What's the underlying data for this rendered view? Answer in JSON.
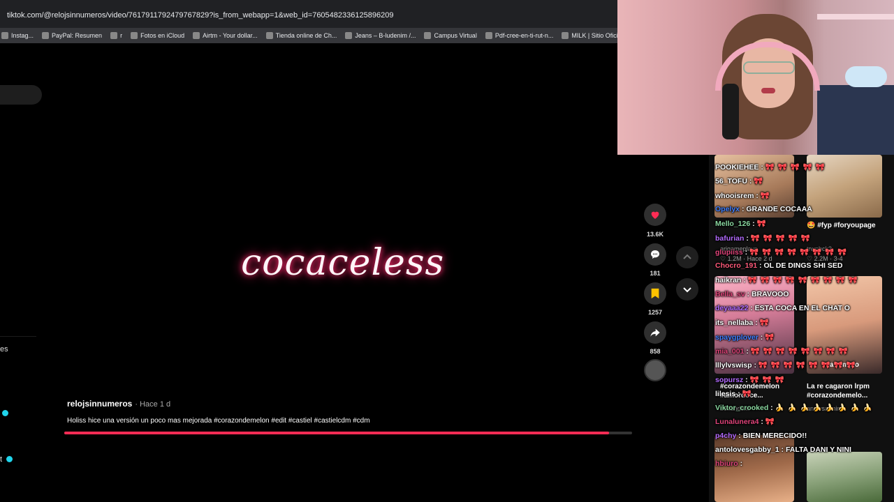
{
  "browser": {
    "url": "tiktok.com/@relojsinnumeros/video/7617911792479767829?is_from_webapp=1&web_id=7605482336125896209",
    "bookmarks": [
      "Instag...",
      "PayPal: Resumen",
      "r",
      "Fotos en iCloud",
      "Airtm - Your dollar...",
      "Tienda online de Ch...",
      "Jeans – B-ludenim /...",
      "Campus Virtual",
      "Pdf-cree-en-ti-rut-n...",
      "MILK | Sitio Oficial |..."
    ]
  },
  "left_fragments": {
    "fragment1": "es",
    "fragment2": "t"
  },
  "video": {
    "title": "cocaceless",
    "author": "relojsinnumeros",
    "time": "· Hace 1 d",
    "caption": "Holiss hice una versión un poco mas mejorada #corazondemelon #edit #castiel #castielcdm #cdm",
    "progress": 0.96
  },
  "actions": {
    "avatar_emoji": "🤢",
    "follow_symbol": "+",
    "likes": "13.6K",
    "comments": "181",
    "saves": "1257",
    "shares": "858"
  },
  "feed": {
    "item1_title": "#fyp #foryoupage",
    "item1_emoji": "🤩",
    "item1_user": "trwpbck3",
    "item1_stats": "♡ 2.2M · 3-4",
    "item0_user": "ariqameplays",
    "item0_stats": "♡ 1.2M · Hace 2 d",
    "item2_overlay": "la rompio",
    "item2_user": "ariqameplays",
    "item3_title": "La re cagaron lrpm #corazondemelo...",
    "item3_user": "annlvsarmin",
    "item2_title": "#corazondemelon #amordoce...",
    "item2_user2": "belfandom"
  },
  "chat": [
    {
      "user": "POOKIEHEE",
      "color": "#ffffff",
      "text": "",
      "bows": "🎀 🎀 🎀 🎀 🎀"
    },
    {
      "user": "56_TOFU",
      "color": "#ffffff",
      "text": "",
      "bows": "🎀"
    },
    {
      "user": "whooisrem",
      "color": "#ffffff",
      "text": "",
      "bows": "🎀"
    },
    {
      "user": "Opelyx",
      "color": "#3f7fff",
      "text": "GRANDE COCAAA",
      "bows": ""
    },
    {
      "user": "Mello_126",
      "color": "#8ad8a0",
      "text": "",
      "bows": "🎀"
    },
    {
      "user": "bafurian",
      "color": "#b36bff",
      "text": "",
      "bows": "🎀 🎀 🎀 🎀 🎀"
    },
    {
      "user": "glupiiss",
      "color": "#e0447a",
      "text": "",
      "bows": "🎀 🎀 🎀 🎀 🎀 🎀 🎀 🎀"
    },
    {
      "user": "Chocro_191",
      "color": "#ff5a7a",
      "text": "OL DE DINGS SHI SED",
      "bows": ""
    },
    {
      "user": "haikran",
      "color": "#ffffff",
      "text": "",
      "bows": "🎀 🎀 🎀 🎀 🎀 🎀 🎀 🎀 🎀"
    },
    {
      "user": "Bella_sv",
      "color": "#e0447a",
      "text": "BRAVOOO",
      "bows": ""
    },
    {
      "user": "deyaaa22",
      "color": "#b36bff",
      "text": "ESTA COCA EN EL CHAT O",
      "bows": ""
    },
    {
      "user": "its_nellaba",
      "color": "#ffffff",
      "text": "",
      "bows": "🎀"
    },
    {
      "user": "spaygplover",
      "color": "#3f7fff",
      "text": "",
      "bows": "🎀"
    },
    {
      "user": "mia_001",
      "color": "#e0447a",
      "text": "",
      "bows": "🎀 🎀 🎀 🎀 🎀 🎀 🎀 🎀"
    },
    {
      "user": "lllylvswisp",
      "color": "#ffffff",
      "text": "",
      "bows": "🎀 🎀 🎀 🎀 🎀 🎀 🎀 🎀"
    },
    {
      "user": "sopursz",
      "color": "#b36bff",
      "text": "",
      "bows": "🎀 🎀 🎀"
    },
    {
      "user": "lilesis",
      "color": "#ffffff",
      "text": "",
      "bows": "🎀"
    },
    {
      "user": "Viktor_crooked",
      "color": "#8ad8a0",
      "text": "",
      "bows": "🍌 🍌 🍌 🍌 🍌 🍌 🍌 🍌"
    },
    {
      "user": "Lunalunera4",
      "color": "#e0447a",
      "text": "",
      "bows": "🎀"
    },
    {
      "user": "p4chy",
      "color": "#b36bff",
      "text": "BIEN MERECIDO!!",
      "bows": ""
    },
    {
      "user": "antolovesgabby_1",
      "color": "#ffffff",
      "text": "FALTA DANI Y NINI",
      "bows": ""
    },
    {
      "user": "hbiuro",
      "color": "#e0447a",
      "text": "",
      "bows": ""
    }
  ]
}
